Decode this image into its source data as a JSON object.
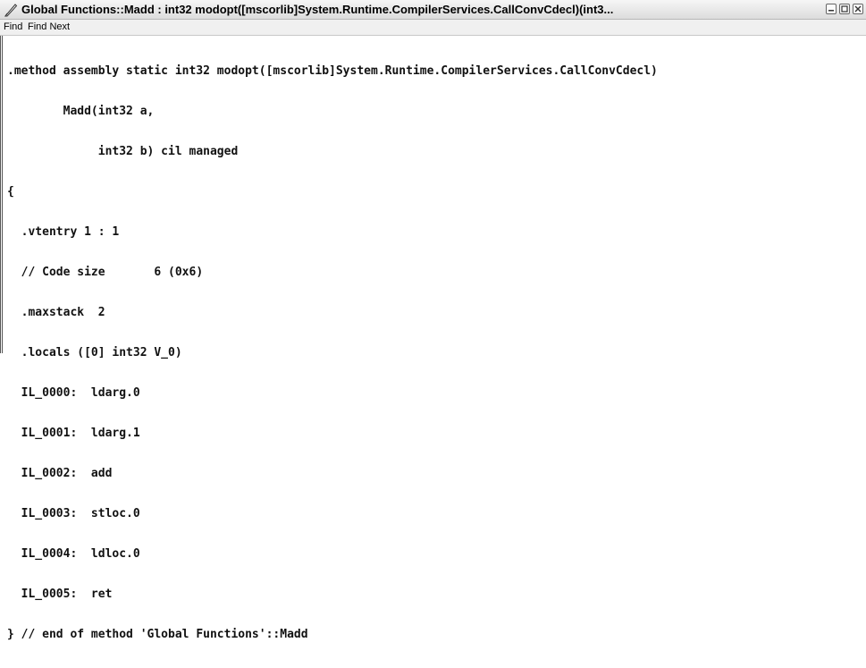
{
  "window": {
    "title": "Global Functions::Madd : int32 modopt([mscorlib]System.Runtime.CompilerServices.CallConvCdecl)(int3..."
  },
  "menu": {
    "items": [
      "Find",
      "Find Next"
    ]
  },
  "code": {
    "lines": [
      ".method assembly static int32 modopt([mscorlib]System.Runtime.CompilerServices.CallConvCdecl)",
      "        Madd(int32 a,",
      "             int32 b) cil managed",
      "{",
      "  .vtentry 1 : 1",
      "  // Code size       6 (0x6)",
      "  .maxstack  2",
      "  .locals ([0] int32 V_0)",
      "  IL_0000:  ldarg.0",
      "  IL_0001:  ldarg.1",
      "  IL_0002:  add",
      "  IL_0003:  stloc.0",
      "  IL_0004:  ldloc.0",
      "  IL_0005:  ret",
      "} // end of method 'Global Functions'::Madd"
    ]
  },
  "icons": {
    "app": "quill-pen-icon",
    "minimize": "minimize-icon",
    "maximize": "maximize-icon",
    "close": "close-icon"
  }
}
